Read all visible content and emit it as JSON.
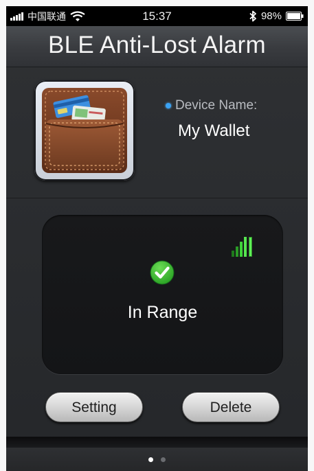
{
  "status_bar": {
    "carrier": "中国联通",
    "time": "15:37",
    "battery": "98%"
  },
  "header": {
    "title": "BLE Anti-Lost Alarm"
  },
  "device": {
    "label": "Device Name:",
    "name": "My Wallet",
    "image_icon": "wallet-icon"
  },
  "status_panel": {
    "state_text": "In Range",
    "state_icon": "check-icon",
    "signal_icon": "signal-strength-icon",
    "state_color": "#2fb12a"
  },
  "actions": {
    "setting_label": "Setting",
    "delete_label": "Delete"
  },
  "pager": {
    "pages": 2,
    "active_index": 0
  },
  "colors": {
    "background": "#2b2d30",
    "accent_dot": "#3aa3f5",
    "signal_green": "#3fd23a"
  }
}
